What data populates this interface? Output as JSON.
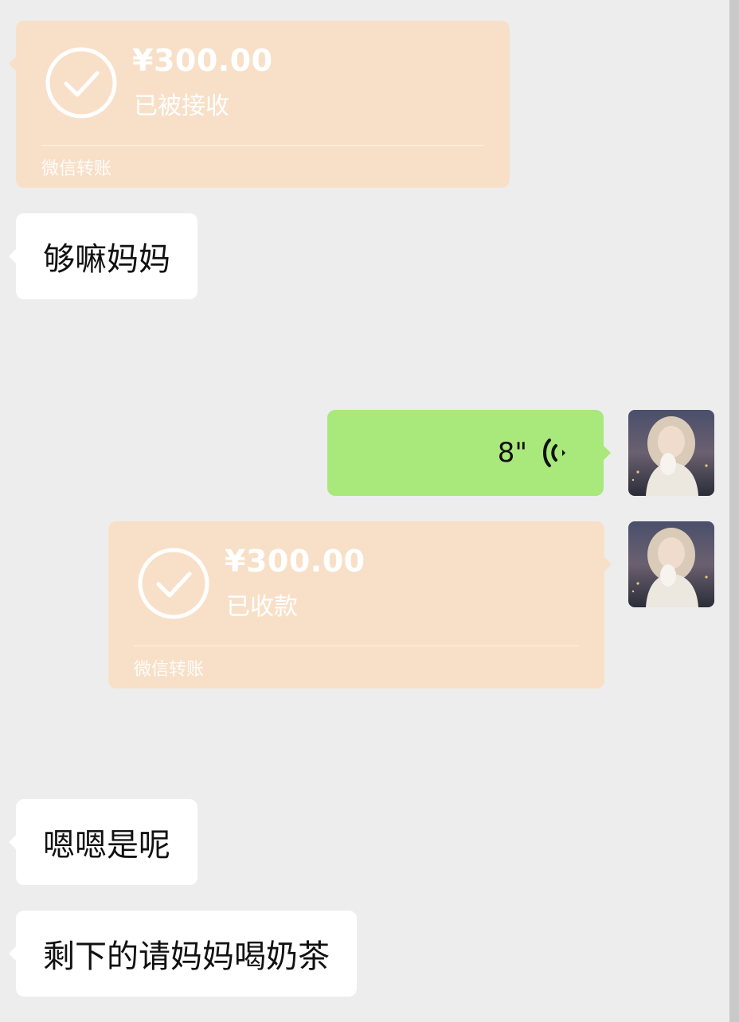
{
  "messages": {
    "m1_transfer": {
      "amount": "¥300.00",
      "status": "已被接收",
      "footer": "微信转账"
    },
    "m2_text": "够嘛妈妈",
    "m3_voice": {
      "duration": "8\""
    },
    "m4_transfer": {
      "amount": "¥300.00",
      "status": "已收款",
      "footer": "微信转账"
    },
    "m5_text": "嗯嗯是呢",
    "m6_text": "剩下的请妈妈喝奶茶"
  },
  "icons": {
    "check": "check-circle-icon",
    "voice": "voice-wave-icon",
    "avatar": "avatar-image"
  },
  "colors": {
    "background": "#ededed",
    "incoming_bubble": "#ffffff",
    "outgoing_bubble": "#a9e87a",
    "transfer_card": "#f8e0c8",
    "text": "#111111"
  }
}
